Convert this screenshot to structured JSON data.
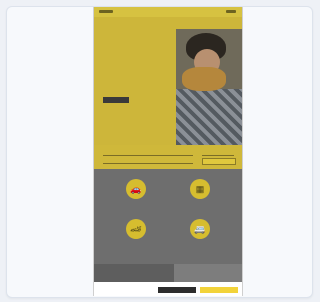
{
  "hero": {
    "title": "",
    "text": "",
    "button": ""
  },
  "categories": [
    {
      "icon": "car-icon",
      "glyph": "🚗",
      "label": ""
    },
    {
      "icon": "calendar-icon",
      "glyph": "▦",
      "label": ""
    },
    {
      "icon": "sports-car-icon",
      "glyph": "🏎",
      "label": ""
    },
    {
      "icon": "van-icon",
      "glyph": "🚐",
      "label": ""
    }
  ],
  "promo": {
    "title": ""
  },
  "cookie": {
    "text": "",
    "decline": "",
    "accept": ""
  },
  "colors": {
    "accent": "#f2d33a",
    "dark": "#2d2d2d"
  }
}
